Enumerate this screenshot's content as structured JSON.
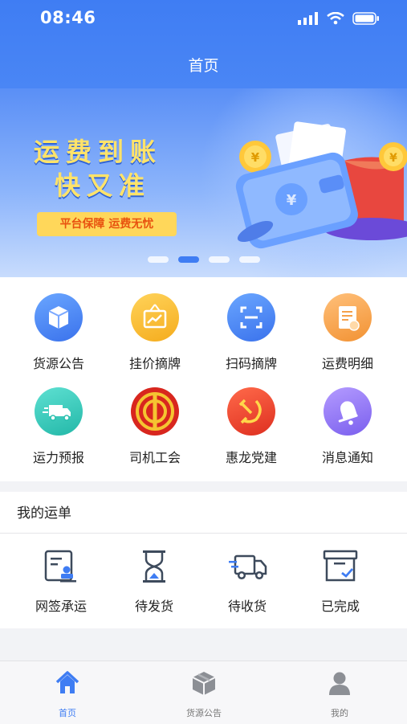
{
  "status_bar": {
    "time": "08:46"
  },
  "header": {
    "title": "首页"
  },
  "banner": {
    "slogan_line1": "运费到账",
    "slogan_line2": "快又准",
    "tag": "平台保障 运费无忧",
    "active_dot_index": 1
  },
  "grid": [
    {
      "label": "货源公告",
      "icon": "box-icon"
    },
    {
      "label": "挂价摘牌",
      "icon": "price-board-icon"
    },
    {
      "label": "扫码摘牌",
      "icon": "scan-icon"
    },
    {
      "label": "运费明细",
      "icon": "bill-icon"
    },
    {
      "label": "运力预报",
      "icon": "truck-icon"
    },
    {
      "label": "司机工会",
      "icon": "union-emblem-icon"
    },
    {
      "label": "惠龙党建",
      "icon": "party-emblem-icon"
    },
    {
      "label": "消息通知",
      "icon": "bell-icon"
    }
  ],
  "orders": {
    "title": "我的运单",
    "items": [
      {
        "label": "网签承运",
        "icon": "contract-icon"
      },
      {
        "label": "待发货",
        "icon": "hourglass-icon"
      },
      {
        "label": "待收货",
        "icon": "delivery-truck-icon"
      },
      {
        "label": "已完成",
        "icon": "completed-box-icon"
      }
    ]
  },
  "tabbar": [
    {
      "label": "首页",
      "icon": "home-icon",
      "active": true
    },
    {
      "label": "货源公告",
      "icon": "cube-icon",
      "active": false
    },
    {
      "label": "我的",
      "icon": "user-icon",
      "active": false
    }
  ],
  "colors": {
    "primary": "#3f7df3",
    "slogan": "#ffe36a",
    "tag_bg": "#ffd75a",
    "tag_text": "#e8520f"
  }
}
